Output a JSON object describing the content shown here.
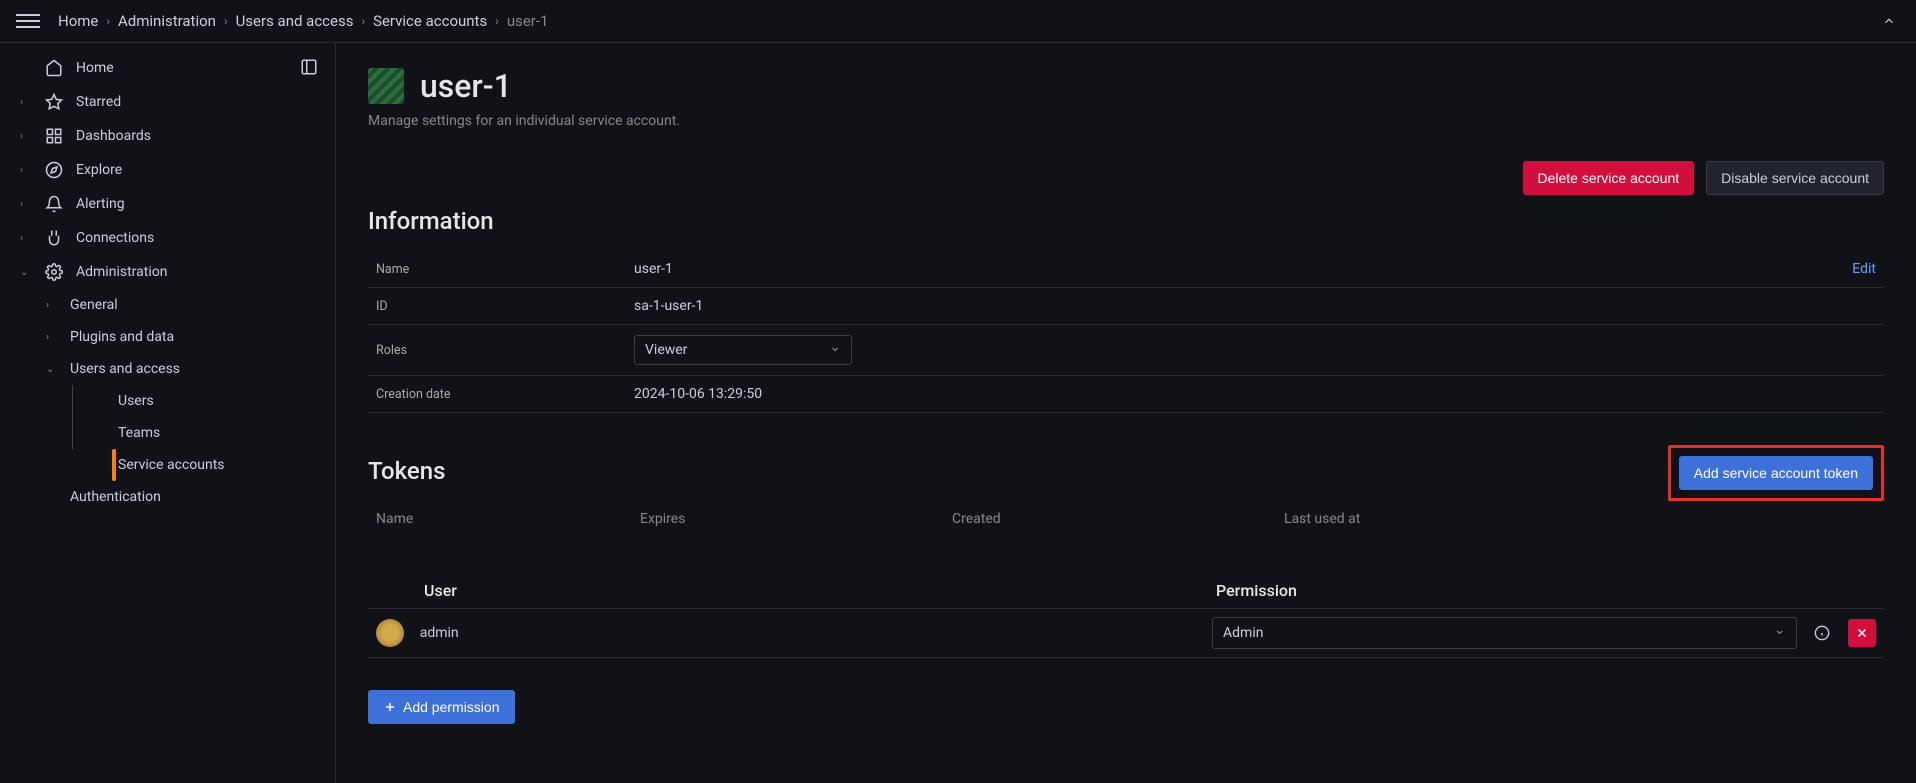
{
  "breadcrumb": {
    "items": [
      "Home",
      "Administration",
      "Users and access",
      "Service accounts"
    ],
    "current": "user-1"
  },
  "sidebar": {
    "home": "Home",
    "starred": "Starred",
    "dashboards": "Dashboards",
    "explore": "Explore",
    "alerting": "Alerting",
    "connections": "Connections",
    "administration": "Administration",
    "general": "General",
    "plugins": "Plugins and data",
    "users_access": "Users and access",
    "users": "Users",
    "teams": "Teams",
    "service_accounts": "Service accounts",
    "authentication": "Authentication"
  },
  "page": {
    "title": "user-1",
    "subtitle": "Manage settings for an individual service account."
  },
  "actions": {
    "delete": "Delete service account",
    "disable": "Disable service account"
  },
  "information": {
    "heading": "Information",
    "name_label": "Name",
    "name_value": "user-1",
    "edit": "Edit",
    "id_label": "ID",
    "id_value": "sa-1-user-1",
    "roles_label": "Roles",
    "roles_value": "Viewer",
    "creation_label": "Creation date",
    "creation_value": "2024-10-06 13:29:50"
  },
  "tokens": {
    "heading": "Tokens",
    "add_button": "Add service account token",
    "columns": {
      "name": "Name",
      "expires": "Expires",
      "created": "Created",
      "last_used": "Last used at"
    }
  },
  "permissions": {
    "user_header": "User",
    "permission_header": "Permission",
    "rows": [
      {
        "user": "admin",
        "permission": "Admin"
      }
    ],
    "add_button": "Add permission"
  }
}
